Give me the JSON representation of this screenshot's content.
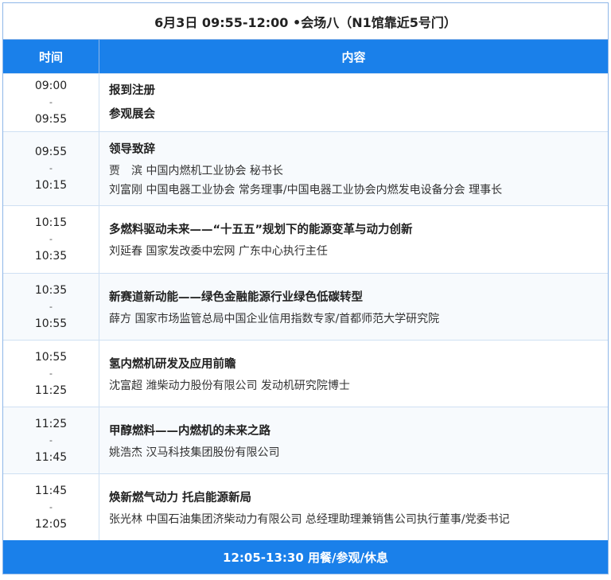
{
  "title": "6月3日 09:55-12:00 •会场八（N1馆靠近5号门）",
  "headers": {
    "time": "时间",
    "content": "内容"
  },
  "rows": [
    {
      "start": "09:00",
      "sep": "-",
      "end": "09:55",
      "items": [
        {
          "text": "报到注册",
          "bold": true
        },
        {
          "text": "参观展会",
          "bold": true
        }
      ]
    },
    {
      "start": "09:55",
      "sep": "-",
      "end": "10:15",
      "items": [
        {
          "text": "领导致辞",
          "bold": true
        },
        {
          "text": "贾　滨 中国内燃机工业协会 秘书长",
          "bold": false
        },
        {
          "text": "刘富刚 中国电器工业协会 常务理事/中国电器工业协会内燃发电设备分会 理事长",
          "bold": false
        }
      ]
    },
    {
      "start": "10:15",
      "sep": "-",
      "end": "10:35",
      "items": [
        {
          "text": "多燃料驱动未来——“十五五”规划下的能源变革与动力创新",
          "bold": true
        },
        {
          "text": "刘延春 国家发改委中宏网 广东中心执行主任",
          "bold": false
        }
      ]
    },
    {
      "start": "10:35",
      "sep": "-",
      "end": "10:55",
      "items": [
        {
          "text": "新赛道新动能——绿色金融能源行业绿色低碳转型",
          "bold": true
        },
        {
          "text": "薛方 国家市场监管总局中国企业信用指数专家/首都师范大学研究院",
          "bold": false
        }
      ]
    },
    {
      "start": "10:55",
      "sep": "-",
      "end": "11:25",
      "items": [
        {
          "text": "氢内燃机研发及应用前瞻",
          "bold": true
        },
        {
          "text": "沈富超 潍柴动力股份有限公司 发动机研究院博士",
          "bold": false
        }
      ]
    },
    {
      "start": "11:25",
      "sep": "-",
      "end": "11:45",
      "items": [
        {
          "text": "甲醇燃料——内燃机的未来之路",
          "bold": true
        },
        {
          "text": "姚浩杰 汉马科技集团股份有限公司",
          "bold": false
        }
      ]
    },
    {
      "start": "11:45",
      "sep": "-",
      "end": "12:05",
      "items": [
        {
          "text": "焕新燃气动力 托启能源新局",
          "bold": true
        },
        {
          "text": "张光林 中国石油集团济柴动力有限公司 总经理助理兼销售公司执行董事/党委书记",
          "bold": false
        }
      ]
    }
  ],
  "footer": "12:05-13:30 用餐/参观/休息"
}
